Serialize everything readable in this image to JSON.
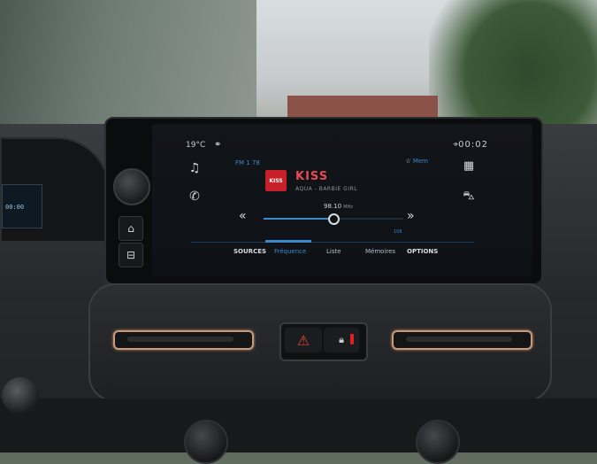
{
  "status": {
    "temperature": "19°C",
    "clock": "00:02"
  },
  "radio": {
    "rds_label": "FM 1 78",
    "fav_label": "Mem",
    "logo_text": "KISS",
    "station": "KISS",
    "song": "AQUA - BARBIE GIRL",
    "frequency": "98.10",
    "frequency_unit": "MHz",
    "band_end": "108",
    "slider_fraction": 0.5
  },
  "tabs": [
    {
      "label": "SOURCES"
    },
    {
      "label": "Fréquence"
    },
    {
      "label": "Liste"
    },
    {
      "label": "Mémoires"
    },
    {
      "label": "OPTIONS"
    }
  ],
  "cluster": {
    "readout": "00:00"
  },
  "colors": {
    "accent": "#3d88c8",
    "station": "#e84a55",
    "hazard": "#e04a3a"
  },
  "icons": {
    "left": [
      "music-note-icon",
      "phone-icon"
    ],
    "right": [
      "apps-grid-icon",
      "car-icon"
    ],
    "transport": [
      "previous-icon",
      "next-icon"
    ]
  }
}
